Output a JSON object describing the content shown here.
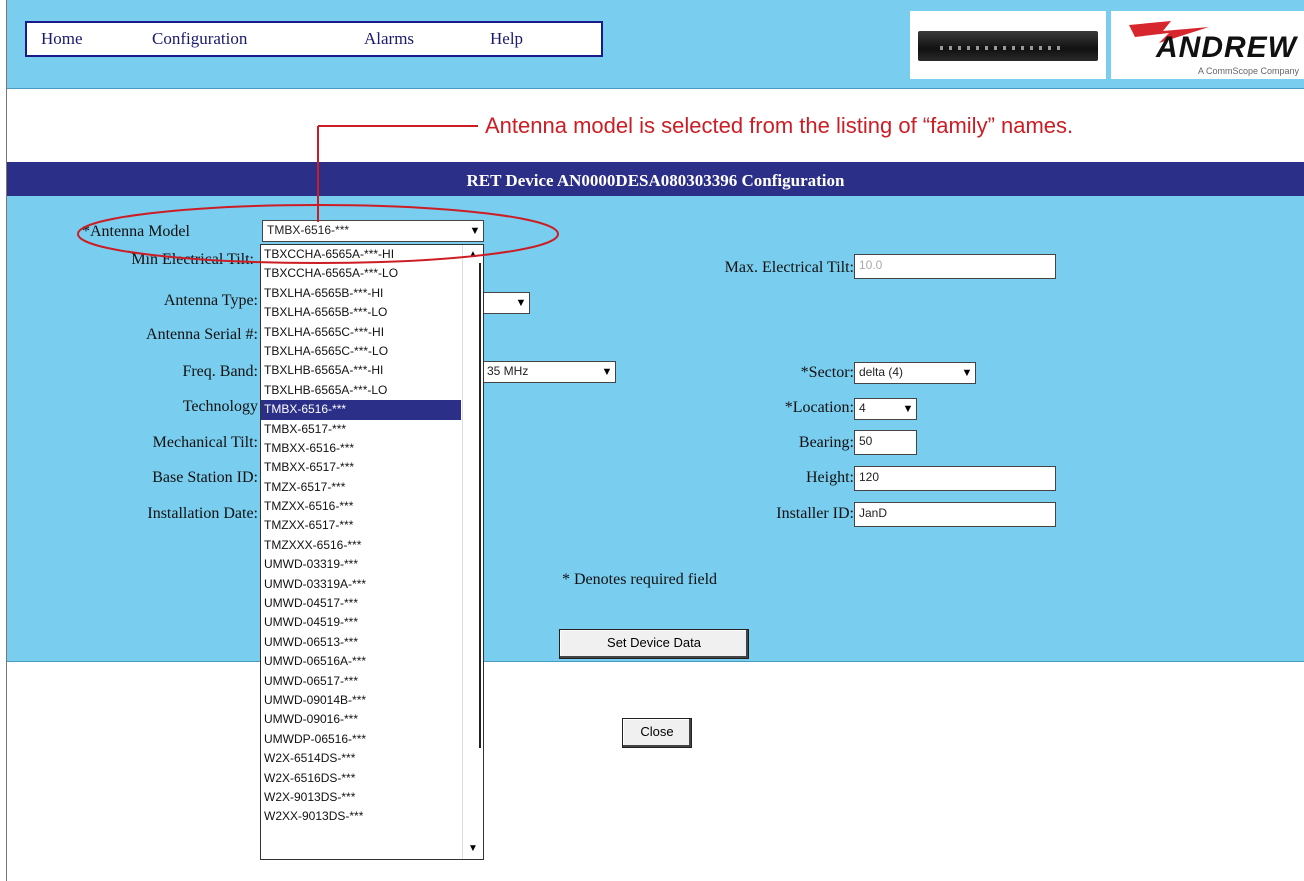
{
  "nav": {
    "items": [
      {
        "label": "Home"
      },
      {
        "label": "Configuration"
      },
      {
        "label": "Alarms"
      },
      {
        "label": "Help"
      }
    ]
  },
  "logo": {
    "brand": "ANDREW",
    "tagline": "A CommScope Company"
  },
  "annotation": "Antenna model is selected from the listing of “family” names.",
  "page_title": "RET Device AN0000DESA080303396 Configuration",
  "form": {
    "antenna_model_label": "*Antenna Model",
    "antenna_model_value": "TMBX-6516-***",
    "min_tilt_label": "Min Electrical Tilt:",
    "max_tilt_label": "Max. Electrical Tilt:",
    "max_tilt_value": "10.0",
    "antenna_type_label": "Antenna Type:",
    "antenna_serial_label": "Antenna Serial #:",
    "freq_band_label": "Freq. Band:",
    "freq_band_value": "35 MHz",
    "technology_label": "Technology",
    "mechanical_tilt_label": "Mechanical Tilt:",
    "base_station_label": "Base Station ID:",
    "install_date_label": "Installation Date:",
    "sector_label": "*Sector:",
    "sector_value": "delta (4)",
    "location_label": "*Location:",
    "location_value": "4",
    "bearing_label": "Bearing:",
    "bearing_value": "50",
    "height_label": "Height:",
    "height_value": "120",
    "installer_label": "Installer ID:",
    "installer_value": "JanD",
    "required_note": "* Denotes required field",
    "set_button": "Set Device Data",
    "close_button": "Close"
  },
  "dropdown": {
    "selected_index": 8,
    "options": [
      "TBXCCHA-6565A-***-HI",
      "TBXCCHA-6565A-***-LO",
      "TBXLHA-6565B-***-HI",
      "TBXLHA-6565B-***-LO",
      "TBXLHA-6565C-***-HI",
      "TBXLHA-6565C-***-LO",
      "TBXLHB-6565A-***-HI",
      "TBXLHB-6565A-***-LO",
      "TMBX-6516-***",
      "TMBX-6517-***",
      "TMBXX-6516-***",
      "TMBXX-6517-***",
      "TMZX-6517-***",
      "TMZXX-6516-***",
      "TMZXX-6517-***",
      "TMZXXX-6516-***",
      "UMWD-03319-***",
      "UMWD-03319A-***",
      "UMWD-04517-***",
      "UMWD-04519-***",
      "UMWD-06513-***",
      "UMWD-06516A-***",
      "UMWD-06517-***",
      "UMWD-09014B-***",
      "UMWD-09016-***",
      "UMWDP-06516-***",
      "W2X-6514DS-***",
      "W2X-6516DS-***",
      "W2X-9013DS-***",
      "W2XX-9013DS-***"
    ]
  },
  "colors": {
    "panel": "#79cdee",
    "band": "#2b2f88",
    "annotation": "#cc1d24"
  }
}
